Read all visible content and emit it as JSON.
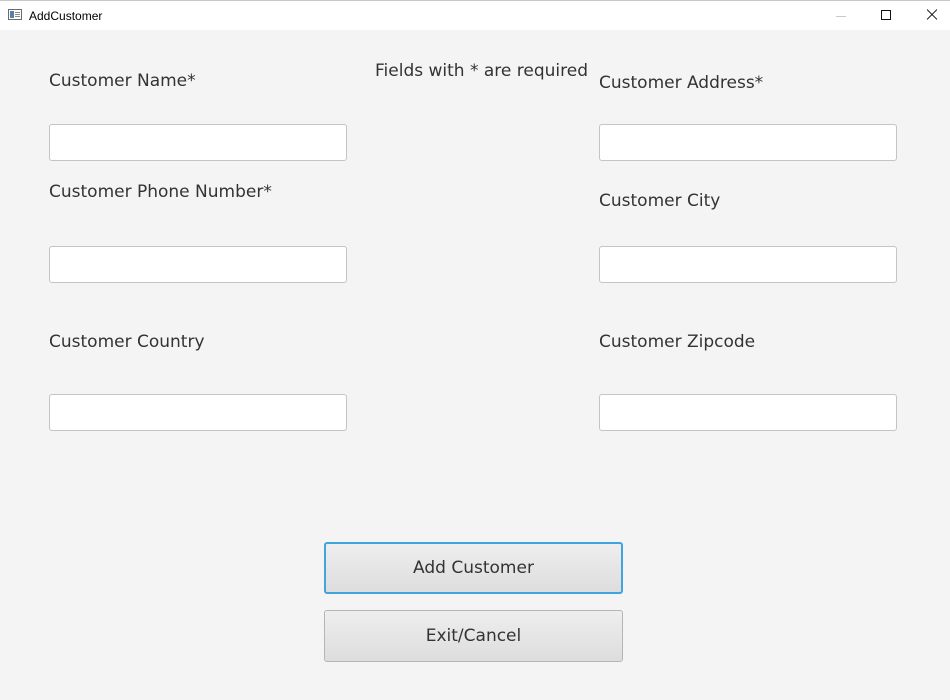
{
  "window": {
    "title": "AddCustomer"
  },
  "form": {
    "required_note": "Fields with * are required",
    "name_label": "Customer Name*",
    "name_value": "",
    "address_label": "Customer Address*",
    "address_value": "",
    "phone_label": "Customer Phone Number*",
    "phone_value": "",
    "city_label": "Customer City",
    "city_value": "",
    "country_label": "Customer Country",
    "country_value": "",
    "zipcode_label": "Customer Zipcode",
    "zipcode_value": ""
  },
  "actions": {
    "add_label": "Add Customer",
    "exit_label": "Exit/Cancel"
  },
  "colors": {
    "background": "#f4f4f4",
    "focus_ring": "#3fa5dc"
  },
  "icons": {
    "app": "app-window-icon",
    "minimize": "minimize-icon",
    "maximize": "maximize-icon",
    "close": "close-icon"
  }
}
